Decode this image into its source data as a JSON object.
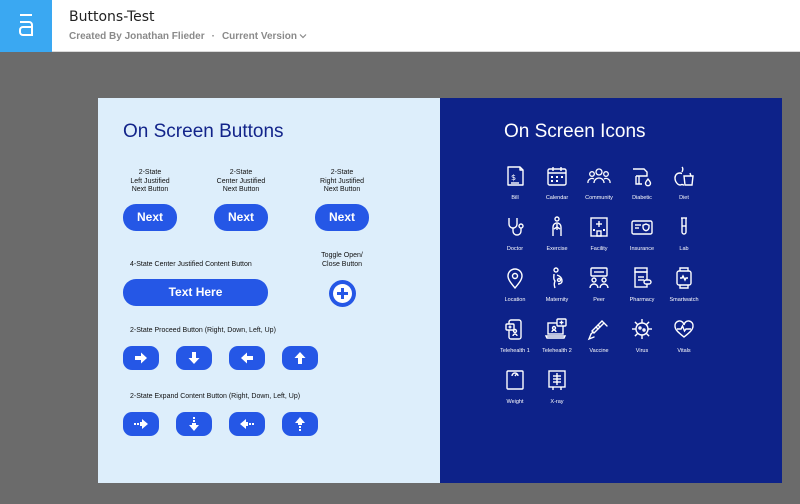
{
  "header": {
    "title": "Buttons-Test",
    "created_by": "Created By Jonathan Flieder",
    "separator": "·",
    "version": "Current Version",
    "logo_icon": "axure-logo-icon",
    "accent_color": "#3aa8f2"
  },
  "buttons_panel": {
    "title": "On Screen Buttons",
    "background": "#ddeefb",
    "button_color": "#2557e6",
    "next_buttons": [
      {
        "caption": "2-State\nLeft Justified\nNext Button",
        "label": "Next"
      },
      {
        "caption": "2-State\nCenter Justified\nNext Button",
        "label": "Next"
      },
      {
        "caption": "2-State\nRight Justified\nNext Button",
        "label": "Next"
      }
    ],
    "content_button": {
      "caption": "4-State Center Justified Content Button",
      "label": "Text Here"
    },
    "toggle_button": {
      "caption": "Toggle Open/\nClose Button",
      "icon": "plus-icon"
    },
    "proceed": {
      "caption": "2-State Proceed Button (Right, Down, Left, Up)",
      "icons": [
        "arrow-right-icon",
        "arrow-down-icon",
        "arrow-left-icon",
        "arrow-up-icon"
      ]
    },
    "expand": {
      "caption": "2-State Expand Content Button (Right, Down, Left, Up)",
      "icons": [
        "expand-right-icon",
        "expand-down-icon",
        "expand-left-icon",
        "expand-up-icon"
      ]
    }
  },
  "icons_panel": {
    "title": "On Screen Icons",
    "background": "#0d2289",
    "icons": [
      {
        "label": "Bill",
        "icon": "bill-icon"
      },
      {
        "label": "Calendar",
        "icon": "calendar-icon"
      },
      {
        "label": "Community",
        "icon": "community-icon"
      },
      {
        "label": "Diabetic",
        "icon": "diabetic-icon"
      },
      {
        "label": "Diet",
        "icon": "diet-icon"
      },
      {
        "label": "Doctor",
        "icon": "doctor-icon"
      },
      {
        "label": "Exercise",
        "icon": "exercise-icon"
      },
      {
        "label": "Facility",
        "icon": "facility-icon"
      },
      {
        "label": "Insurance",
        "icon": "insurance-icon"
      },
      {
        "label": "Lab",
        "icon": "lab-icon"
      },
      {
        "label": "Location",
        "icon": "location-icon"
      },
      {
        "label": "Maternity",
        "icon": "maternity-icon"
      },
      {
        "label": "Peer",
        "icon": "peer-icon"
      },
      {
        "label": "Pharmacy",
        "icon": "pharmacy-icon"
      },
      {
        "label": "Smartwatch",
        "icon": "smartwatch-icon"
      },
      {
        "label": "Telehealth 1",
        "icon": "telehealth-1-icon"
      },
      {
        "label": "Telehealth 2",
        "icon": "telehealth-2-icon"
      },
      {
        "label": "Vaccine",
        "icon": "vaccine-icon"
      },
      {
        "label": "Virus",
        "icon": "virus-icon"
      },
      {
        "label": "Vitals",
        "icon": "vitals-icon"
      },
      {
        "label": "Weight",
        "icon": "weight-icon"
      },
      {
        "label": "X-ray",
        "icon": "x-ray-icon"
      }
    ]
  }
}
